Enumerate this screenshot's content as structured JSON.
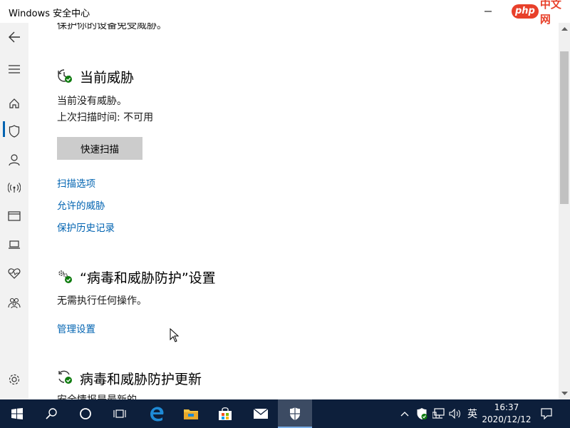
{
  "window": {
    "title": "Windows 安全中心",
    "watermark_brand": "php",
    "watermark_text": "中文网"
  },
  "main": {
    "cut_off_text": "保护你的设备免受威胁。",
    "current_threats": {
      "heading": "当前威胁",
      "status": "当前没有威胁。",
      "last_scan": "上次扫描时间: 不可用",
      "quick_scan_button": "快速扫描",
      "links": [
        "扫描选项",
        "允许的威胁",
        "保护历史记录"
      ]
    },
    "settings": {
      "heading": "“病毒和威胁防护”设置",
      "status": "无需执行任何操作。",
      "link": "管理设置"
    },
    "updates": {
      "heading": "病毒和威胁防护更新",
      "cut_off_text": "安全情报是最新的"
    }
  },
  "sidebar": {
    "items": [
      "back-icon",
      "menu-icon",
      "home-icon",
      "shield-icon",
      "person-icon",
      "wifi-icon",
      "browser-icon",
      "laptop-icon",
      "heart-icon",
      "family-icon",
      "settings-icon"
    ],
    "active": "shield-icon"
  },
  "taskbar": {
    "time": "16:37",
    "date": "2020/12/12",
    "ime": "英",
    "apps": [
      "start-icon",
      "search-icon",
      "cortana-icon",
      "task-view-icon",
      "edge-icon",
      "file-explorer-icon",
      "store-icon",
      "mail-icon",
      "security-icon"
    ],
    "accent_color": "#0d1f3b"
  },
  "colors": {
    "link": "#0063b1",
    "button": "#cccccc",
    "sidebar_bg": "#f2f2f2",
    "ok_green": "#107c10"
  }
}
